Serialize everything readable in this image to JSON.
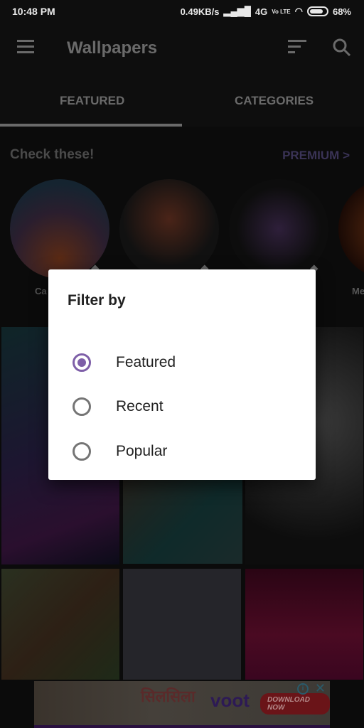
{
  "status_bar": {
    "time": "10:48 PM",
    "net_speed": "0.49KB/s",
    "network": "4G",
    "volte": "Vo LTE",
    "battery": "68%"
  },
  "app_bar": {
    "title": "Wallpapers",
    "icons": [
      "menu-icon",
      "filter-icon",
      "search-icon"
    ]
  },
  "tabs": [
    {
      "label": "FEATURED",
      "active": true
    },
    {
      "label": "CATEGORIES",
      "active": false
    }
  ],
  "section": {
    "title": "Check these!",
    "premium_link": "PREMIUM >"
  },
  "collections": [
    {
      "label": "Ca",
      "premium": true
    },
    {
      "label": "",
      "premium": true
    },
    {
      "label": "",
      "premium": true
    },
    {
      "label": "Me",
      "premium": false
    }
  ],
  "dialog": {
    "title": "Filter by",
    "options": [
      {
        "label": "Featured",
        "selected": true
      },
      {
        "label": "Recent",
        "selected": false
      },
      {
        "label": "Popular",
        "selected": false
      }
    ],
    "accent_color": "#7e5fa8"
  },
  "ad": {
    "hindi_text": "सिलसिला",
    "brand": "voot",
    "cta": "DOWNLOAD NOW"
  }
}
